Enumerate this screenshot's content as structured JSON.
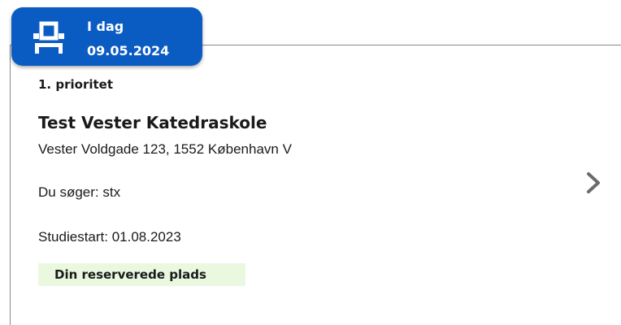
{
  "date_tab": {
    "icon": "desk-chair-icon",
    "day_label": "I dag",
    "date": "09.05.2024"
  },
  "application": {
    "priority": "1. prioritet",
    "school_name": "Test Vester Katedraskole",
    "address": "Vester Voldgade 123, 1552 København V",
    "program": "Du søger: stx",
    "study_start": "Studiestart: 01.08.2023",
    "status_badge": "Din reserverede plads",
    "chevron_icon": "chevron-right-icon"
  },
  "colors": {
    "tab_background": "#0b5cc2",
    "badge_background": "#eaf8e0",
    "chevron": "#6b6b6b"
  }
}
